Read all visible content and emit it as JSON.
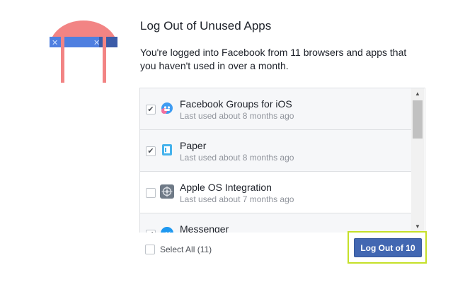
{
  "heading": {
    "title": "Log Out of Unused Apps"
  },
  "description": "You're logged into Facebook from 11 browsers and apps that you haven't used in over a month.",
  "apps": [
    {
      "name": "Facebook Groups for iOS",
      "last_used": "Last used about 8 months ago",
      "checked": true,
      "icon": "groups-icon"
    },
    {
      "name": "Paper",
      "last_used": "Last used about 8 months ago",
      "checked": true,
      "icon": "paper-icon"
    },
    {
      "name": "Apple OS Integration",
      "last_used": "Last used about 7 months ago",
      "checked": false,
      "icon": "gear-icon"
    },
    {
      "name": "Messenger",
      "last_used": "",
      "checked": true,
      "icon": "messenger-icon"
    }
  ],
  "footer": {
    "select_all_label": "Select All (11)",
    "logout_button_label": "Log Out of 10"
  },
  "colors": {
    "primary_button": "#4267b2",
    "highlight_border": "#c5e029",
    "illustration_red": "#f28484",
    "illustration_blue": "#4f7fe0"
  }
}
